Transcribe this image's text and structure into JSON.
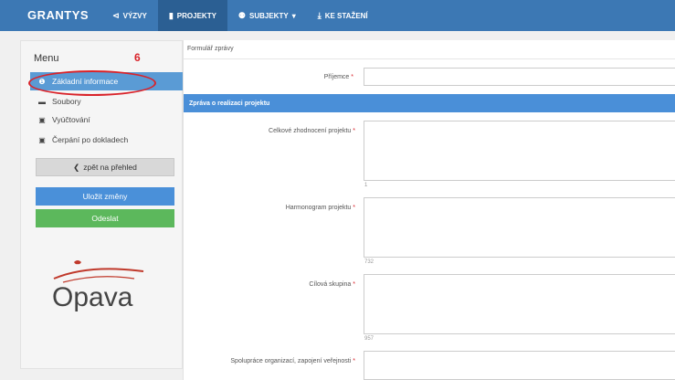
{
  "navbar": {
    "brand": "GRANTYS",
    "items": [
      {
        "label": "VÝZVY",
        "icon": "megaphone-icon",
        "glyph": "⊲"
      },
      {
        "label": "PROJEKTY",
        "icon": "file-icon",
        "glyph": "▮"
      },
      {
        "label": "SUBJEKTY",
        "icon": "users-icon",
        "glyph": "⚉",
        "caret": "▾"
      },
      {
        "label": "KE STAŽENÍ",
        "icon": "download-icon",
        "glyph": "⤓"
      }
    ]
  },
  "sidebar": {
    "title": "Menu",
    "step_number": "6",
    "items": [
      {
        "label": "Základní informace",
        "icon": "info-icon",
        "glyph": "❶"
      },
      {
        "label": "Soubory",
        "icon": "folder-icon",
        "glyph": "▬"
      },
      {
        "label": "Vyúčtování",
        "icon": "money-icon",
        "glyph": "▣"
      },
      {
        "label": "Čerpání po dokladech",
        "icon": "money-icon",
        "glyph": "▣"
      }
    ],
    "back_button": "zpět na přehled",
    "back_glyph": "❮",
    "save_button": "Uložit změny",
    "send_button": "Odeslat",
    "logo_text": "Opava"
  },
  "main": {
    "breadcrumb": "Formulář zprávy",
    "recipient_label": "Příjemce",
    "section_title": "Zpráva o realizaci projektu",
    "fields": [
      {
        "label": "Celkové zhodnocení projektu",
        "counter": "1"
      },
      {
        "label": "Harmonogram projektu",
        "counter": "732"
      },
      {
        "label": "Cílová skupina",
        "counter": "957"
      },
      {
        "label": "Spolupráce organizací, zapojení veřejnosti",
        "counter": ""
      }
    ],
    "required_mark": "*"
  },
  "colors": {
    "navbar": "#3c78b4",
    "active_nav": "#2b5f93",
    "sidebar_active": "#5a9bd5",
    "save": "#4a90d9",
    "send": "#5cb85c",
    "section_bar": "#4a8fd8",
    "annotation_red": "#d9232a"
  }
}
